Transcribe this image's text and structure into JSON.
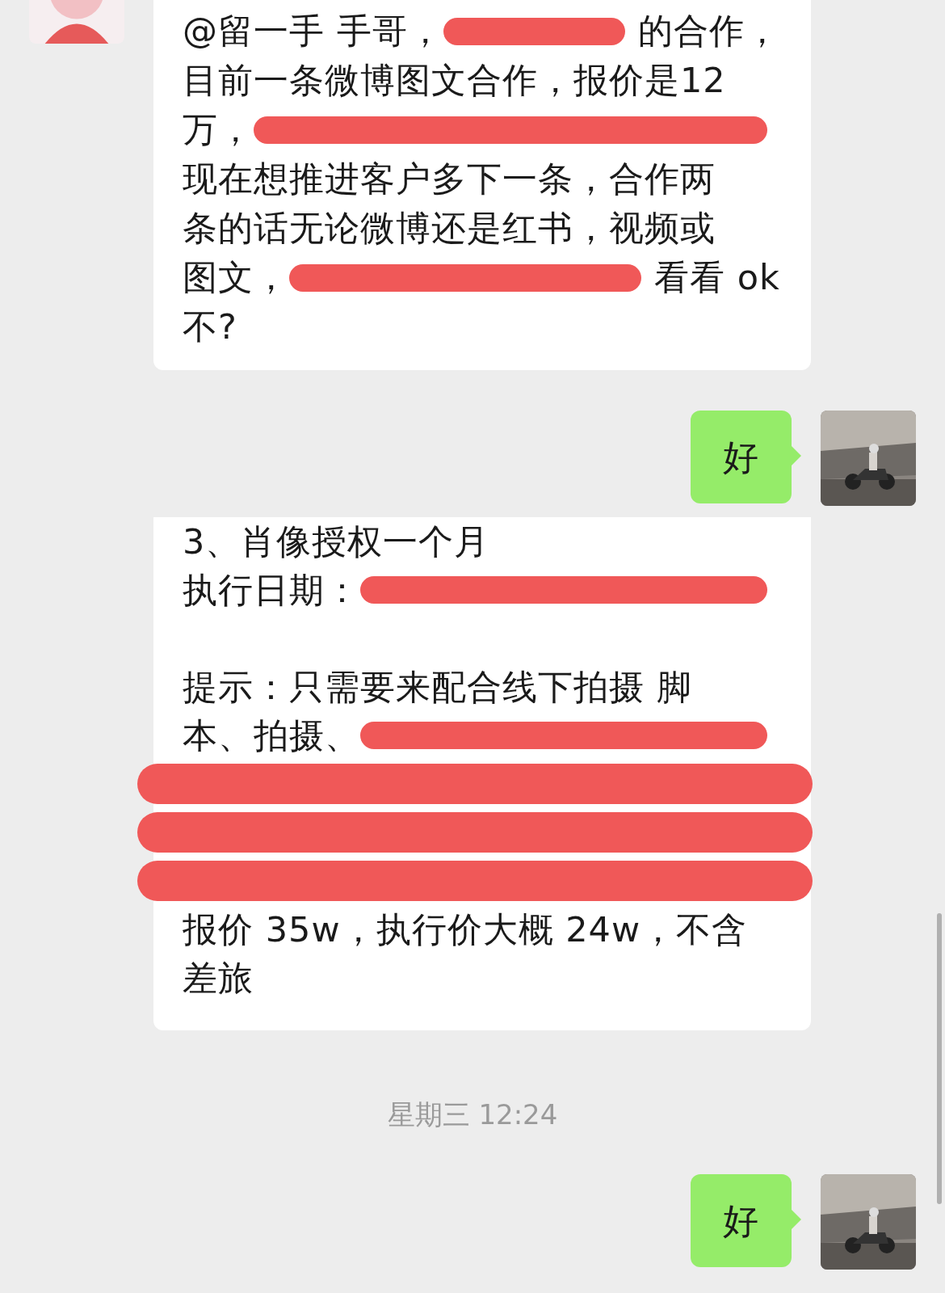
{
  "messages": [
    {
      "kind": "incoming_with_avatar",
      "lines": [
        {
          "segments": [
            {
              "kind": "text",
              "text": "@留一手 手哥，"
            },
            {
              "kind": "redaction"
            },
            {
              "kind": "text",
              "text": "的合作，"
            }
          ]
        },
        {
          "segments": [
            {
              "kind": "text",
              "text": "目前一条微博图文合作，报价是12"
            }
          ]
        },
        {
          "segments": [
            {
              "kind": "text",
              "text": "万，"
            },
            {
              "kind": "redaction"
            }
          ]
        },
        {
          "segments": [
            {
              "kind": "text",
              "text": "现在想推进客户多下一条，合作两"
            }
          ]
        },
        {
          "segments": [
            {
              "kind": "text",
              "text": "条的话无论微博还是红书，视频或"
            }
          ]
        },
        {
          "segments": [
            {
              "kind": "text",
              "text": "图文，"
            },
            {
              "kind": "redaction"
            },
            {
              "kind": "text",
              "text": "看看 ok"
            }
          ]
        },
        {
          "segments": [
            {
              "kind": "text",
              "text": "不?"
            }
          ]
        }
      ]
    },
    {
      "kind": "outgoing",
      "lines": [
        {
          "segments": [
            {
              "kind": "text",
              "text": "好"
            }
          ]
        }
      ]
    },
    {
      "kind": "incoming",
      "lines": [
        {
          "segments": [
            {
              "kind": "text",
              "text": "3、肖像授权一个月"
            }
          ]
        },
        {
          "segments": [
            {
              "kind": "text",
              "text": "执行日期："
            },
            {
              "kind": "redaction"
            }
          ]
        },
        {
          "kind": "blank"
        },
        {
          "segments": [
            {
              "kind": "text",
              "text": "提示：只需要来配合线下拍摄 脚"
            }
          ]
        },
        {
          "segments": [
            {
              "kind": "text",
              "text": "本、拍摄、"
            },
            {
              "kind": "redaction"
            }
          ]
        },
        {
          "segments": [
            {
              "kind": "redaction"
            }
          ]
        },
        {
          "segments": [
            {
              "kind": "redaction"
            }
          ]
        },
        {
          "segments": [
            {
              "kind": "redaction"
            }
          ]
        },
        {
          "segments": [
            {
              "kind": "text",
              "text": "报价 35w，执行价大概 24w，不含"
            }
          ]
        },
        {
          "segments": [
            {
              "kind": "text",
              "text": "差旅"
            }
          ]
        }
      ]
    },
    {
      "kind": "timestamp",
      "text": "星期三 12:24"
    },
    {
      "kind": "outgoing",
      "lines": [
        {
          "segments": [
            {
              "kind": "text",
              "text": "好"
            }
          ]
        }
      ]
    }
  ]
}
